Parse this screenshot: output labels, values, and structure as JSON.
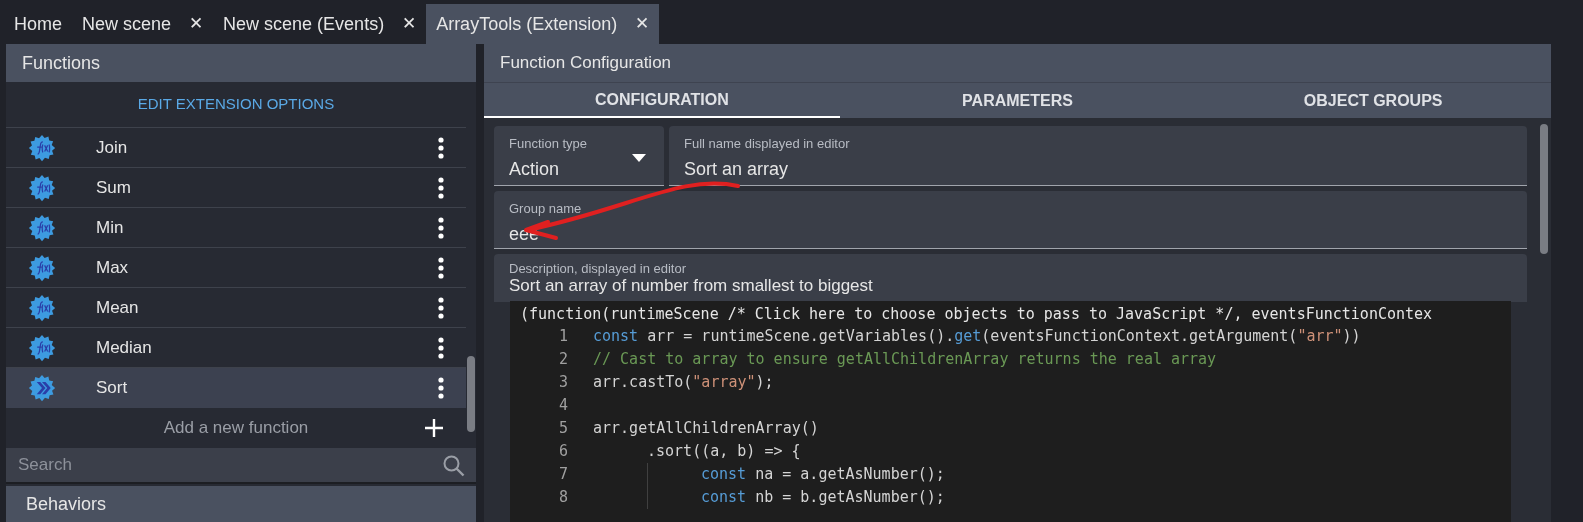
{
  "tabs": [
    {
      "label": "Home",
      "selected": false
    },
    {
      "label": "New scene",
      "selected": false,
      "close": "✕"
    },
    {
      "label": "New scene (Events)",
      "selected": false,
      "close": "✕"
    },
    {
      "label": "ArrayTools (Extension)",
      "selected": true,
      "close": "✕"
    }
  ],
  "functions_panel": {
    "title": "Functions",
    "edit_options": "EDIT EXTENSION OPTIONS",
    "items": [
      {
        "label": "Join",
        "kind": "expression",
        "selected": false
      },
      {
        "label": "Sum",
        "kind": "expression",
        "selected": false
      },
      {
        "label": "Min",
        "kind": "expression",
        "selected": false
      },
      {
        "label": "Max",
        "kind": "expression",
        "selected": false
      },
      {
        "label": "Mean",
        "kind": "expression",
        "selected": false
      },
      {
        "label": "Median",
        "kind": "expression",
        "selected": false
      },
      {
        "label": "Sort",
        "kind": "action",
        "selected": true
      }
    ],
    "add_function": "Add a new function",
    "search": {
      "placeholder": "Search"
    }
  },
  "behaviors_panel": {
    "title": "Behaviors"
  },
  "configuration": {
    "title": "Function Configuration",
    "tabs": [
      {
        "label": "CONFIGURATION",
        "selected": true
      },
      {
        "label": "PARAMETERS",
        "selected": false
      },
      {
        "label": "OBJECT GROUPS",
        "selected": false
      }
    ],
    "function_type": {
      "label": "Function type",
      "value": "Action"
    },
    "full_name": {
      "label": "Full name displayed in editor",
      "value": "Sort an array"
    },
    "group_name": {
      "label": "Group name",
      "value": "eee"
    },
    "description": {
      "label": "Description, displayed in editor",
      "value": "Sort an array of number from smallest to biggest"
    },
    "code_header": "(function(runtimeScene /* Click here to choose objects to pass to JavaScript */, eventsFunctionContex",
    "code_lines": [
      {
        "number": "1",
        "tokens": [
          {
            "kind": "keyword",
            "text": "const"
          },
          {
            "kind": "plain",
            "text": " arr = runtimeScene.getVariables()."
          },
          {
            "kind": "keyword",
            "text": "get"
          },
          {
            "kind": "plain",
            "text": "(eventsFunctionContext.getArgument("
          },
          {
            "kind": "string",
            "text": "\"arr\""
          },
          {
            "kind": "plain",
            "text": "))"
          }
        ]
      },
      {
        "number": "2",
        "tokens": [
          {
            "kind": "comment",
            "text": "// Cast to array to ensure getAllChildrenArray returns the real array"
          }
        ]
      },
      {
        "number": "3",
        "tokens": [
          {
            "kind": "plain",
            "text": "arr.castTo("
          },
          {
            "kind": "string",
            "text": "\"array\""
          },
          {
            "kind": "plain",
            "text": ");"
          }
        ]
      },
      {
        "number": "4"
      },
      {
        "number": "5",
        "tokens": [
          {
            "kind": "plain",
            "text": "arr.getAllChildrenArray()"
          }
        ],
        "children": [
          {
            "number": "6",
            "tokens": [
              {
                "kind": "plain",
                "text": ".sort((a, b) => {"
              }
            ],
            "children": [
              {
                "number": "7",
                "tokens": [
                  {
                    "kind": "keyword",
                    "text": "const"
                  },
                  {
                    "kind": "plain",
                    "text": " na = a.getAsNumber();"
                  }
                ]
              },
              {
                "number": "8",
                "tokens": [
                  {
                    "kind": "keyword",
                    "text": "const"
                  },
                  {
                    "kind": "plain",
                    "text": " nb = b.getAsNumber();"
                  }
                ]
              }
            ]
          }
        ]
      }
    ]
  }
}
